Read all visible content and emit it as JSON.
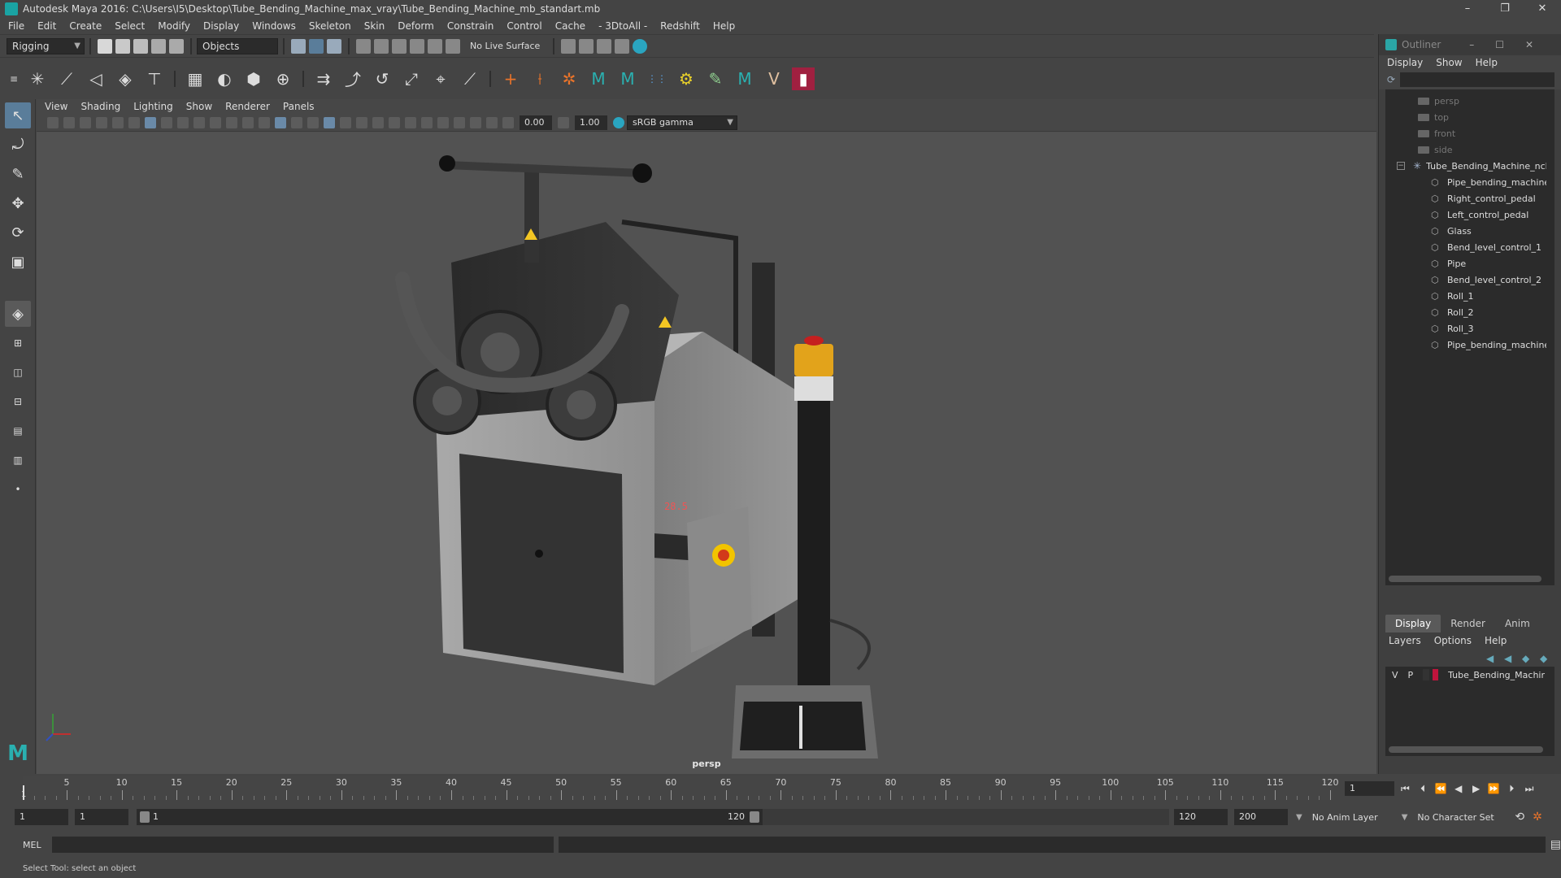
{
  "window": {
    "title": "Autodesk Maya 2016: C:\\Users\\I5\\Desktop\\Tube_Bending_Machine_max_vray\\Tube_Bending_Machine_mb_standart.mb",
    "min": "–",
    "max": "❐",
    "close": "✕"
  },
  "menubar": [
    "File",
    "Edit",
    "Create",
    "Select",
    "Modify",
    "Display",
    "Windows",
    "Skeleton",
    "Skin",
    "Deform",
    "Constrain",
    "Control",
    "Cache",
    "- 3DtoAll -",
    "Redshift",
    "Help"
  ],
  "statusline": {
    "mode": "Rigging",
    "objects": "Objects",
    "live_surface": "No Live Surface"
  },
  "panel_menu": [
    "View",
    "Shading",
    "Lighting",
    "Show",
    "Renderer",
    "Panels"
  ],
  "panel_bar": {
    "exposure": "0.00",
    "gamma": "1.00",
    "color_space": "sRGB gamma"
  },
  "viewport": {
    "camera": "persp",
    "display_value": "28.5"
  },
  "outliner": {
    "title": "Outliner",
    "menu": [
      "Display",
      "Show",
      "Help"
    ],
    "cameras": [
      "persp",
      "top",
      "front",
      "side"
    ],
    "root": "Tube_Bending_Machine_ncl",
    "children": [
      "Pipe_bending_machine_",
      "Right_control_pedal",
      "Left_control_pedal",
      "Glass",
      "Bend_level_control_1",
      "Pipe",
      "Bend_level_control_2",
      "Roll_1",
      "Roll_2",
      "Roll_3",
      "Pipe_bending_machine"
    ]
  },
  "layer_editor": {
    "tabs": [
      "Display",
      "Render",
      "Anim"
    ],
    "menu": [
      "Layers",
      "Options",
      "Help"
    ],
    "layer": {
      "v": "V",
      "p": "P",
      "name": "Tube_Bending_Machir"
    }
  },
  "timeline": {
    "ticks": [
      5,
      10,
      15,
      20,
      25,
      30,
      35,
      40,
      45,
      50,
      55,
      60,
      65,
      70,
      75,
      80,
      85,
      90,
      95,
      100,
      105,
      110,
      115,
      120
    ],
    "current_label": "1",
    "current_frame": "1"
  },
  "range": {
    "start": "1",
    "playback_start": "1",
    "slider_start": "1",
    "slider_end": "120",
    "playback_end": "120",
    "end": "200",
    "anim_layer": "No Anim Layer",
    "character_set": "No Character Set"
  },
  "cmdline": {
    "label": "MEL"
  },
  "help": {
    "text": "Select Tool: select an object"
  }
}
